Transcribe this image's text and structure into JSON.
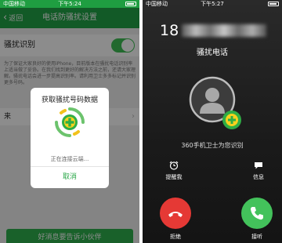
{
  "left": {
    "status": {
      "carrier": "中国移动",
      "time": "下午5:24"
    },
    "nav": {
      "back_label": "返回",
      "title": "电话防骚扰设置"
    },
    "toggle_row": {
      "label": "骚扰识别",
      "on": true
    },
    "description": "为了保证大家良好的使用iPhone，目前版本在骚扰电话识别率上适当做了妥协。在我们找到更好的解决方法之前，还请大家理解。骚扰电话会进一步提高识别率。请利用卫士多多标记并识别更多号码。",
    "behind_row_label": "来",
    "bottom_button": "好消息要告诉小伙伴",
    "dialog": {
      "title": "获取骚扰号码数据",
      "status": "正在连接云端...",
      "cancel": "取消"
    },
    "accent_color": "#22a447"
  },
  "right": {
    "status": {
      "carrier": "中国移动",
      "time": "下午5:27"
    },
    "caller_prefix": "18",
    "caller_tag": "骚扰电话",
    "identified_by": "360手机卫士为您识别",
    "actions": {
      "remind": "提醒我",
      "message": "信息"
    },
    "decline_label": "拒绝",
    "accept_label": "接听",
    "decline_color": "#e53935",
    "accept_color": "#43c25b"
  }
}
